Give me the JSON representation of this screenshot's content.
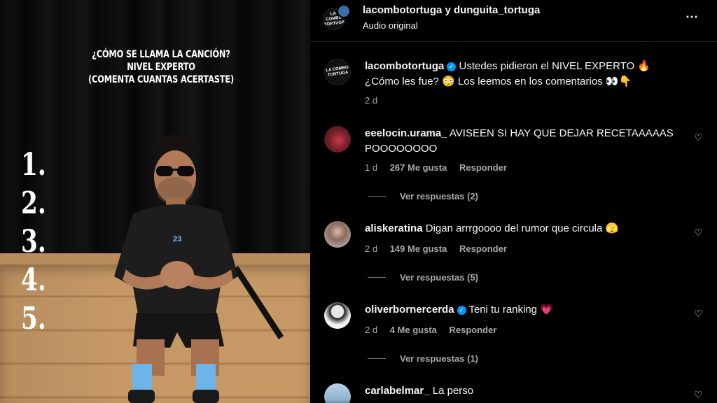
{
  "video": {
    "question_lines": [
      "¿CÓMO SE LLAMA LA CANCIÓN?",
      "NIVEL EXPERTO",
      "(COMENTA CUANTAS ACERTASTE)"
    ],
    "numbers": [
      "1.",
      "2.",
      "3.",
      "4.",
      "5."
    ],
    "shirt_number": "23"
  },
  "header": {
    "users": "lacombotortuga y dunguita_tortuga",
    "audio": "Audio original",
    "more_icon": "⋯",
    "avatar_logo": "LA COMBO TORTUGA"
  },
  "caption": {
    "user": "lacombotortuga",
    "line1": "Ustedes pidieron el NIVEL EXPERTO",
    "line1_emoji": "🔥",
    "line2_a": "¿Cómo les fue?",
    "line2_emoji": "😳",
    "line2_b": "Los leemos en los comentarios",
    "line2_emoji2": "👀👇",
    "time": "2 d"
  },
  "comments": [
    {
      "user": "eeelocin.urama_",
      "text": "AVISEEN SI HAY QUE DEJAR RECETAAAAAS",
      "text2": "POOOOOOOO",
      "time": "1 d",
      "likes": "267 Me gusta",
      "reply": "Responder",
      "replies": "Ver respuestas (2)"
    },
    {
      "user": "aliskeratina",
      "text": "Digan arrrgoooo del rumor que circula",
      "emoji": "🫣",
      "time": "2 d",
      "likes": "149 Me gusta",
      "reply": "Responder",
      "replies": "Ver respuestas (5)"
    },
    {
      "user": "oliverbornercerda",
      "text": "Teni tu ranking",
      "emoji": "💗",
      "time": "2 d",
      "likes": "4 Me gusta",
      "reply": "Responder",
      "replies": "Ver respuestas (1)"
    },
    {
      "user": "carlabelmar_",
      "text": "La perso"
    }
  ],
  "icons": {
    "heart": "♡",
    "verified": "✓"
  },
  "colors": {
    "background": "#000000",
    "text": "#f5f5f5",
    "muted": "#a8a8a8",
    "verified": "#0095f6"
  }
}
